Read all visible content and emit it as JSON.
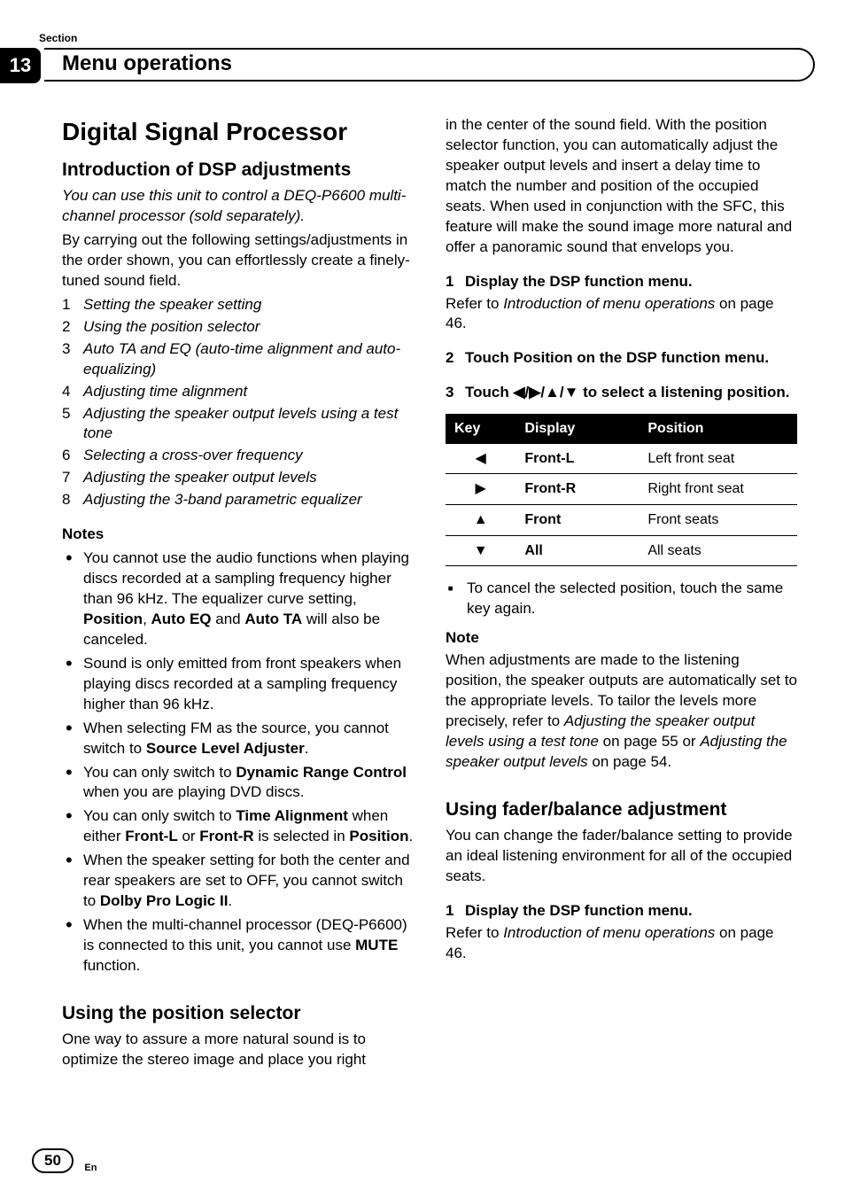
{
  "section_label": "Section",
  "chapter_number": "13",
  "chapter_title": "Menu operations",
  "left": {
    "main_heading": "Digital Signal Processor",
    "sub_heading_1": "Introduction of DSP adjustments",
    "intro_italic": "You can use this unit to control a DEQ-P6600 multi-channel processor (sold separately).",
    "intro_plain": "By carrying out the following settings/adjustments in the order shown, you can effortlessly create a finely-tuned sound field.",
    "numbered": [
      "Setting the speaker setting",
      "Using the position selector",
      "Auto TA and EQ (auto-time alignment and auto-equalizing)",
      "Adjusting time alignment",
      "Adjusting the speaker output levels using a test tone",
      "Selecting a cross-over frequency",
      "Adjusting the speaker output levels",
      "Adjusting the 3-band parametric equalizer"
    ],
    "notes_heading": "Notes",
    "note1_a": "You cannot use the audio functions when playing discs recorded at a sampling frequency higher than 96 kHz. The equalizer curve setting, ",
    "note1_b1": "Position",
    "note1_c": ", ",
    "note1_b2": "Auto EQ",
    "note1_d": " and ",
    "note1_b3": "Auto TA",
    "note1_e": " will also be canceled.",
    "note2": "Sound is only emitted from front speakers when playing discs recorded at a sampling frequency higher than 96 kHz.",
    "note3_a": "When selecting FM as the source, you cannot switch to ",
    "note3_b": "Source Level Adjuster",
    "note3_c": ".",
    "note4_a": "You can only switch to ",
    "note4_b": "Dynamic Range Control",
    "note4_c": " when you are playing DVD discs.",
    "note5_a": "You can only switch to ",
    "note5_b": "Time Alignment",
    "note5_c": " when either ",
    "note5_d": "Front-L",
    "note5_e": " or ",
    "note5_f": "Front-R",
    "note5_g": " is selected in ",
    "note5_h": "Position",
    "note5_i": ".",
    "note6_a": "When the speaker setting for both the center and rear speakers are set to OFF, you cannot switch to ",
    "note6_b": "Dolby Pro Logic II",
    "note6_c": ".",
    "note7_a": "When the multi-channel processor (DEQ-P6600) is connected to this unit, you cannot use ",
    "note7_b": "MUTE",
    "note7_c": " function.",
    "sub_heading_2": "Using the position selector",
    "pos_intro": "One way to assure a more natural sound is to optimize the stereo image and place you right"
  },
  "right": {
    "cont_para": "in the center of the sound field. With the position selector function, you can automatically adjust the speaker output levels and insert a delay time to match the number and position of the occupied seats. When used in conjunction with the SFC, this feature will make the sound image more natural and offer a panoramic sound that envelops you.",
    "step1_n": "1",
    "step1_t": "Display the DSP function menu.",
    "step1_body_a": "Refer to ",
    "step1_body_i": "Introduction of menu operations",
    "step1_body_b": " on page 46.",
    "step2_n": "2",
    "step2_t": "Touch Position on the DSP function menu.",
    "step3_n": "3",
    "step3_t_a": "Touch ",
    "step3_t_sym": "◀/▶/▲/▼",
    "step3_t_b": " to select a listening position.",
    "table": {
      "h1": "Key",
      "h2": "Display",
      "h3": "Position",
      "rows": [
        {
          "k": "◀",
          "d": "Front-L",
          "p": "Left front seat"
        },
        {
          "k": "▶",
          "d": "Front-R",
          "p": "Right front seat"
        },
        {
          "k": "▲",
          "d": "Front",
          "p": "Front seats"
        },
        {
          "k": "▼",
          "d": "All",
          "p": "All seats"
        }
      ]
    },
    "sub_bullet": "To cancel the selected position, touch the same key again.",
    "note_heading": "Note",
    "note_para_a": "When adjustments are made to the listening position, the speaker outputs are automatically set to the appropriate levels. To tailor the levels more precisely, refer to ",
    "note_para_i1": "Adjusting the speaker output levels using a test tone",
    "note_para_b": " on page 55 or ",
    "note_para_i2": "Adjusting the speaker output levels",
    "note_para_c": " on page 54.",
    "sub_heading_3": "Using fader/balance adjustment",
    "fader_intro": "You can change the fader/balance setting to provide an ideal listening environment for all of the occupied seats.",
    "fstep1_n": "1",
    "fstep1_t": "Display the DSP function menu.",
    "fstep1_body_a": "Refer to ",
    "fstep1_body_i": "Introduction of menu operations",
    "fstep1_body_b": " on page 46."
  },
  "page_number": "50",
  "lang_label": "En"
}
